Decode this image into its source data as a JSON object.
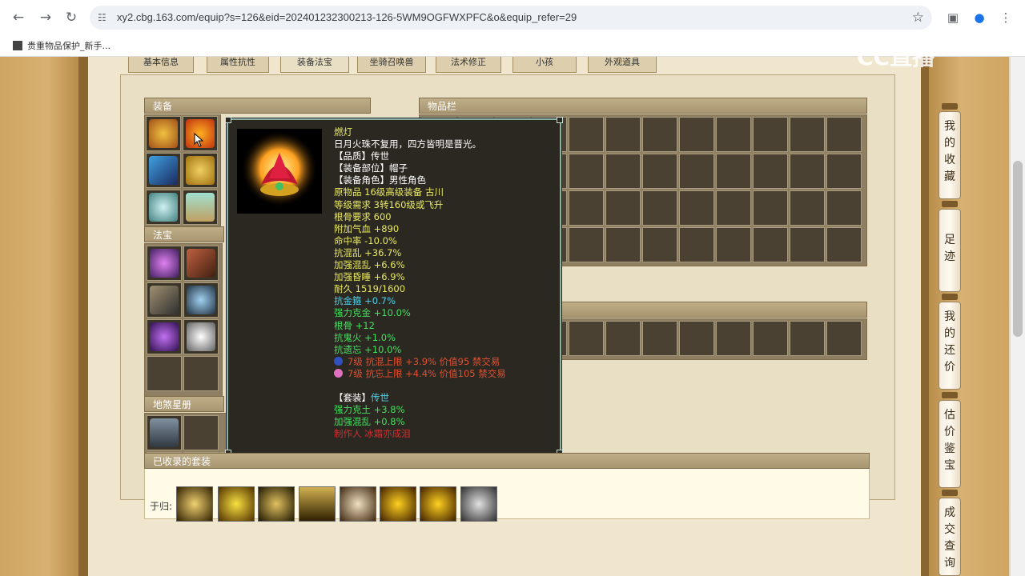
{
  "browser": {
    "url": "xy2.cbg.163.com/equip?s=126&eid=202401232300213-126-5WM9OGFWXPFC&o&equip_refer=29",
    "bookmark": "贵重物品保护_新手..."
  },
  "tabs": [
    "基本信息",
    "属性抗性",
    "装备法宝",
    "坐骑召唤兽",
    "法术修正",
    "小孩",
    "外观道具"
  ],
  "sections": {
    "equip": "装备",
    "fabao": "法宝",
    "disha": "地煞星册",
    "inventory": "物品栏",
    "suits": "已收录的套装",
    "suit_row_label": "于归:"
  },
  "tooltip": {
    "lines": [
      {
        "text": "燃灯",
        "color": "#e8e860"
      },
      {
        "text": "日月火珠不复用，四方皆明是晋光。",
        "color": "#ffffff"
      },
      {
        "text": "【品质】传世",
        "color": "#ffffff"
      },
      {
        "text": "【装备部位】帽子",
        "color": "#ffffff"
      },
      {
        "text": "【装备角色】男性角色",
        "color": "#ffffff"
      },
      {
        "text": "原物品 16级高级装备 古川",
        "color": "#e8e860"
      },
      {
        "text": "等级需求 3转160级或飞升",
        "color": "#e8e860"
      },
      {
        "text": "根骨要求 600",
        "color": "#e8e860"
      },
      {
        "text": "附加气血 +890",
        "color": "#e8e860"
      },
      {
        "text": "命中率 -10.0%",
        "color": "#e8e860"
      },
      {
        "text": "抗混乱 +36.7%",
        "color": "#e8e860"
      },
      {
        "text": "加强混乱 +6.6%",
        "color": "#e8e860"
      },
      {
        "text": "加强昏睡 +6.9%",
        "color": "#e8e860"
      },
      {
        "text": "耐久 1519/1600",
        "color": "#e8e860"
      },
      {
        "text": "抗金箍 +0.7%",
        "color": "#4fd0e8"
      },
      {
        "text": "强力克金 +10.0%",
        "color": "#44e060"
      },
      {
        "text": "根骨 +12",
        "color": "#44e060"
      },
      {
        "text": "抗鬼火 +1.0%",
        "color": "#44e060"
      },
      {
        "text": "抗遗忘 +10.0%",
        "color": "#44e060"
      },
      {
        "text": "7级 抗混上限 +3.9% 价值95 禁交易",
        "color": "#e05030",
        "gem": "#3050c0"
      },
      {
        "text": "7级 抗忘上限 +4.4% 价值105 禁交易",
        "color": "#e05030",
        "gem": "#e070c0"
      },
      {
        "text": "",
        "color": "#ffffff"
      },
      {
        "text": "【套装】传世",
        "color": "#ffffff",
        "suffix": "传世",
        "suffix_color": "#4fd0e8"
      },
      {
        "text": "强力克土 +3.8%",
        "color": "#44e060"
      },
      {
        "text": "加强混乱 +0.8%",
        "color": "#44e060"
      },
      {
        "text": "制作人 冰霜亦成泪",
        "color": "#d03030"
      }
    ]
  },
  "float_menu": [
    {
      "label": "我的收藏"
    },
    {
      "label": "足迹"
    },
    {
      "label": "我的还价"
    },
    {
      "label": "估价鉴宝"
    },
    {
      "label": "成交查询"
    }
  ],
  "watermark": "CC直播",
  "colors": {
    "accent": "#a89571",
    "panel": "#e9dfc4",
    "tooltip_bg": "#2b2822"
  }
}
